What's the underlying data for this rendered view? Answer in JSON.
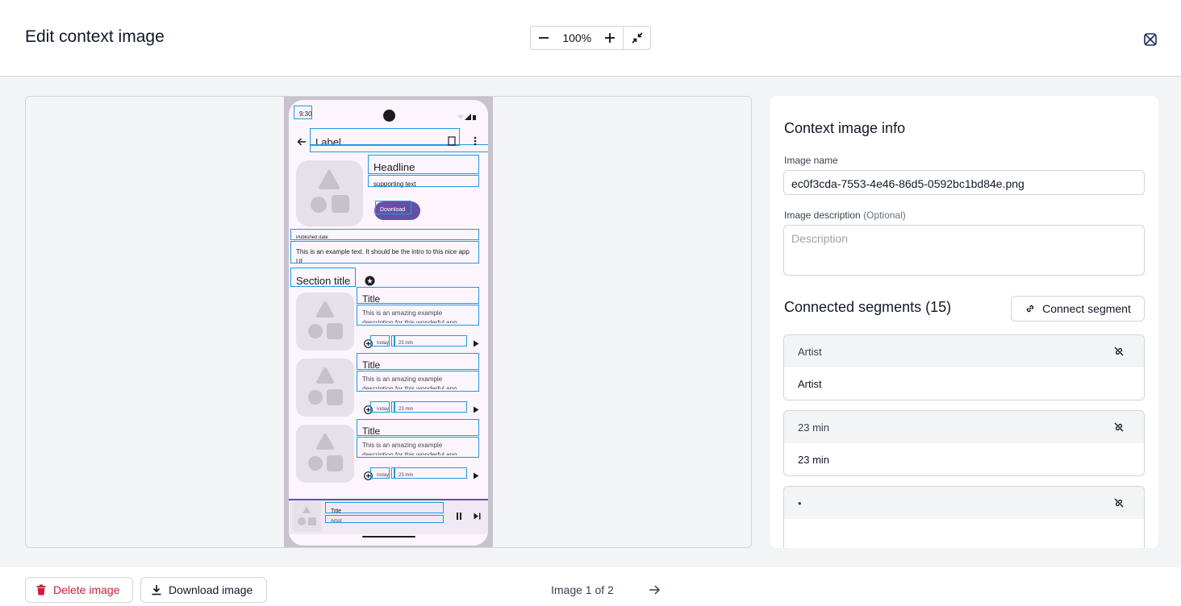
{
  "header": {
    "title": "Edit context image",
    "zoom": {
      "value": "100%",
      "minus": "−",
      "plus": "+"
    }
  },
  "phone": {
    "time": "9:30",
    "top_label": "Label",
    "headline": "Headline",
    "supporting": "supporting text",
    "download": "Download",
    "published": "Published date",
    "intro": "This is an example text. It should be the intro to this nice app UI",
    "section_title": "Section title",
    "items": [
      {
        "title": "Title",
        "desc": "This is an amazing example description for this wonderful app",
        "today": "Today",
        "dur": "23 min"
      },
      {
        "title": "Title",
        "desc": "This is an amazing example description for this wonderful app",
        "today": "Today",
        "dur": "23 min"
      },
      {
        "title": "Title",
        "desc": "This is an amazing example description for this wonderful app",
        "today": "Today",
        "dur": "23 min"
      }
    ],
    "player": {
      "title": "Title",
      "artist": "Artist"
    }
  },
  "panel": {
    "heading": "Context image info",
    "name_label": "Image name",
    "name_value": "ec0f3cda-7553-4e46-86d5-0592bc1bd84e.png",
    "desc_label": "Image description",
    "desc_optional": "(Optional)",
    "desc_placeholder": "Description",
    "segments_title": "Connected segments (15)",
    "connect_label": "Connect segment",
    "segments": [
      {
        "label": "Artist",
        "value": "Artist"
      },
      {
        "label": "23 min",
        "value": "23 min"
      },
      {
        "label": "•",
        "value": ""
      }
    ]
  },
  "footer": {
    "delete_label": "Delete image",
    "download_label": "Download image",
    "pager": "Image 1 of 2"
  },
  "colors": {
    "accent_box": "#1e9be0",
    "danger": "#c81e3c",
    "phone_button": "#6750a4"
  }
}
